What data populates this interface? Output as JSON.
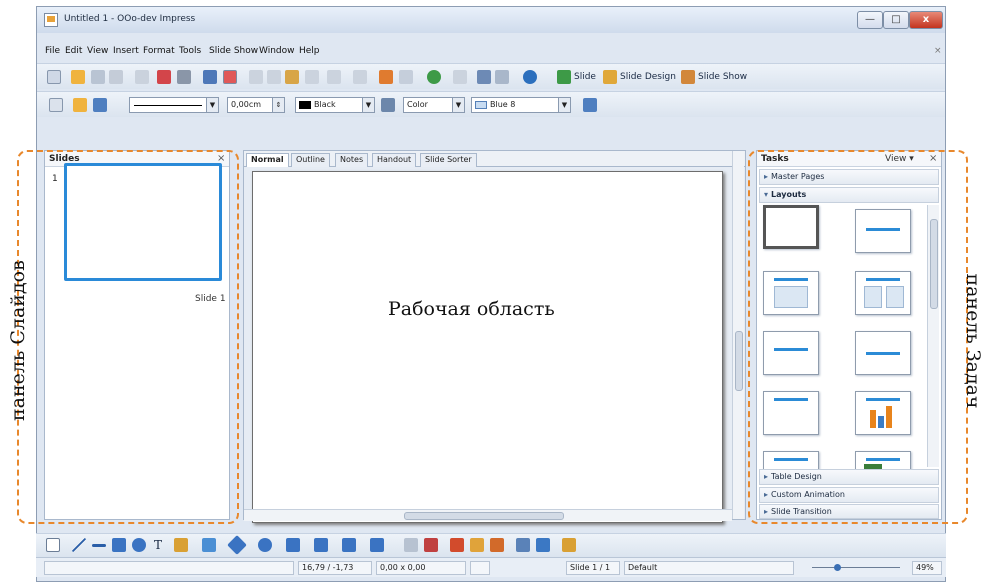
{
  "window": {
    "title": "Untitled 1 - OOo-dev Impress",
    "min_label": "—",
    "max_label": "□",
    "close_label": "x"
  },
  "menubar": {
    "items": [
      "File",
      "Edit",
      "View",
      "Insert",
      "Format",
      "Tools",
      "Slide Show",
      "Window",
      "Help"
    ],
    "doc_close": "×"
  },
  "toolbar1": {
    "slide_label": "Slide",
    "slide_design_label": "Slide Design",
    "slide_show_label": "Slide Show"
  },
  "toolbar2": {
    "line_width": "0,00cm",
    "line_color": "Black",
    "area_style": "Color",
    "area_color": "Blue 8"
  },
  "slides_panel": {
    "title": "Slides",
    "close": "×",
    "slide_number": "1",
    "slide_caption": "Slide 1"
  },
  "work_area": {
    "tabs": [
      "Normal",
      "Outline",
      "Notes",
      "Handout",
      "Slide Sorter"
    ],
    "active_tab": "Normal"
  },
  "tasks_panel": {
    "title": "Tasks",
    "view_label": "View",
    "close": "×",
    "sections_top": [
      "Master Pages",
      "Layouts"
    ],
    "sections_bottom": [
      "Table Design",
      "Custom Animation",
      "Slide Transition"
    ]
  },
  "statusbar": {
    "position": "16,79 / -1,73",
    "size": "0,00 x 0,00",
    "slide_info": "Slide 1 / 1",
    "master": "Default",
    "zoom": "49%"
  },
  "annotations": {
    "left": "панель Слайдов",
    "center": "Рабочая область",
    "right": "панель Задач"
  },
  "colors": {
    "annotation_dash": "#e8882c",
    "selection_blue": "#2a8ad8"
  }
}
